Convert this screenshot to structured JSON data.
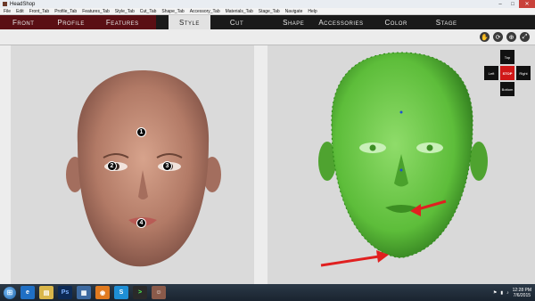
{
  "window": {
    "title": "HeadShop"
  },
  "menu": [
    "File",
    "Edit",
    "Front_Tab",
    "Profile_Tab",
    "Features_Tab",
    "Style_Tab",
    "Cut_Tab",
    "Shape_Tab",
    "Accessory_Tab",
    "Materials_Tab",
    "Stage_Tab",
    "Navigate",
    "Help"
  ],
  "tabs_left": [
    "Front",
    "Profile",
    "Features"
  ],
  "tabs_right": [
    "Style",
    "Cut",
    "Shape",
    "Accessories",
    "Color",
    "Stage"
  ],
  "active_tab": "Style",
  "markers": [
    "1",
    "2",
    "3",
    "4"
  ],
  "nav": {
    "top": "Top",
    "left": "Left",
    "stop": "STOP",
    "right": "Right",
    "bottom": "Bottom"
  },
  "taskbar": {
    "time": "12:28 PM",
    "date": "7/6/2015"
  },
  "icons": [
    "start-orb-icon",
    "ie-icon",
    "explorer-icon",
    "photoshop-icon",
    "folder-icon",
    "firefox-icon",
    "skype-icon",
    "terminal-icon",
    "headshop-icon"
  ],
  "colors": {
    "accent_tab": "#5a0f14",
    "arrow": "#e02020",
    "mesh": "#5dbd3a",
    "stop": "#d01818"
  }
}
